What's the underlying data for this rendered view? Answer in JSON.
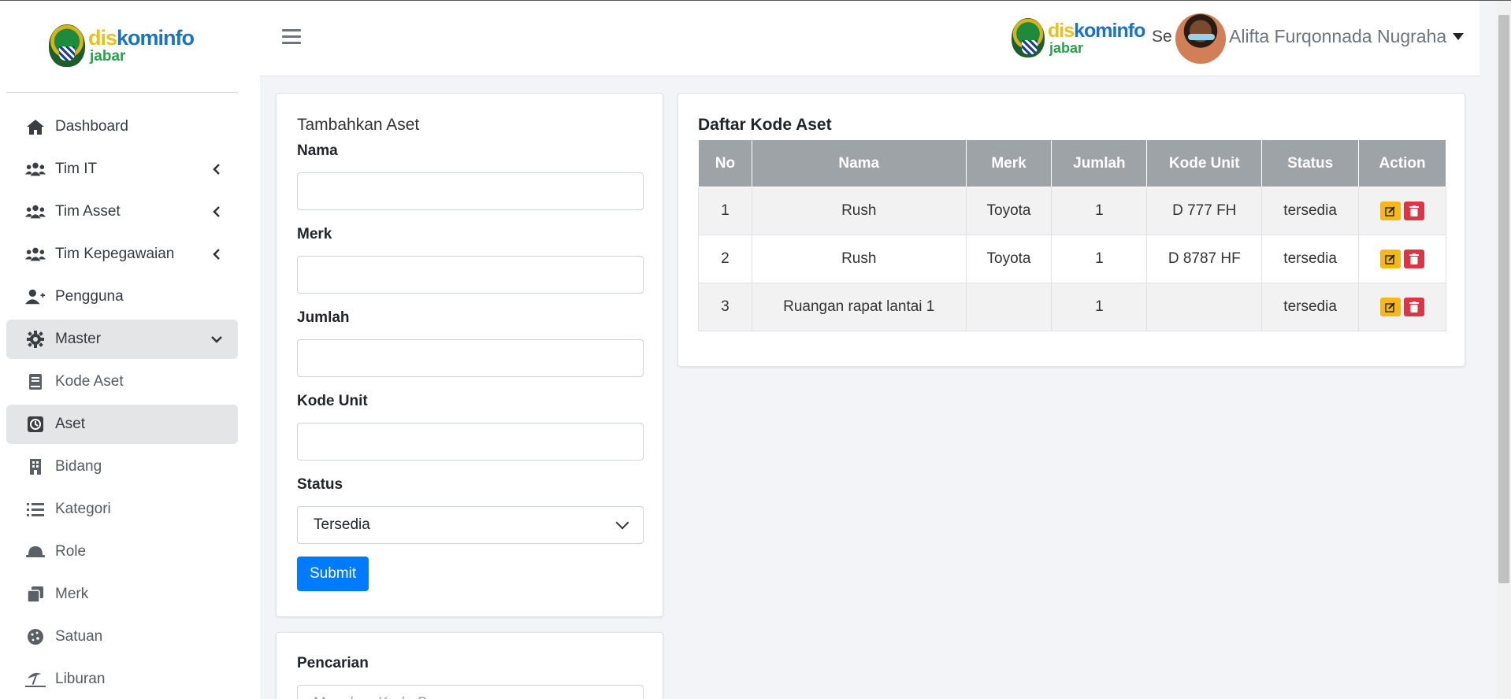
{
  "sidebar": {
    "brand": {
      "part1": "dis",
      "part2": "kominfo",
      "part3": "jabar"
    },
    "items": [
      {
        "label": "Dashboard",
        "icon": "home-icon"
      },
      {
        "label": "Tim IT",
        "icon": "users-icon",
        "has_chevron": true
      },
      {
        "label": "Tim Asset",
        "icon": "users-icon",
        "has_chevron": true
      },
      {
        "label": "Tim Kepegawaian",
        "icon": "users-icon",
        "has_chevron": true
      },
      {
        "label": "Pengguna",
        "icon": "user-plus-icon"
      },
      {
        "label": "Master",
        "icon": "gear-icon",
        "expanded": true
      },
      {
        "label": "Kode Aset",
        "icon": "book-icon"
      },
      {
        "label": "Aset",
        "icon": "clock-icon",
        "active": true
      },
      {
        "label": "Bidang",
        "icon": "building-icon"
      },
      {
        "label": "Kategori",
        "icon": "list-icon"
      },
      {
        "label": "Role",
        "icon": "helmet-icon"
      },
      {
        "label": "Merk",
        "icon": "copy-icon"
      },
      {
        "label": "Satuan",
        "icon": "cookie-icon"
      },
      {
        "label": "Liburan",
        "icon": "umbrella-beach-icon"
      }
    ]
  },
  "header": {
    "brand": {
      "part1": "dis",
      "part2": "kominfo",
      "part3": "jabar"
    },
    "truncated_text": "Se",
    "username": "Alifta Furqonnada Nugraha"
  },
  "form": {
    "title": "Tambahkan Aset",
    "labels": {
      "nama": "Nama",
      "merk": "Merk",
      "jumlah": "Jumlah",
      "kode_unit": "Kode Unit",
      "status": "Status"
    },
    "values": {
      "nama": "",
      "merk": "",
      "jumlah": "",
      "kode_unit": ""
    },
    "status_selected": "Tersedia",
    "submit_label": "Submit"
  },
  "search": {
    "label": "Pencarian",
    "placeholder": "Masukan Kode Barang"
  },
  "table": {
    "title": "Daftar Kode Aset",
    "headers": [
      "No",
      "Nama",
      "Merk",
      "Jumlah",
      "Kode Unit",
      "Status",
      "Action"
    ],
    "rows": [
      [
        "1",
        "Rush",
        "Toyota",
        "1",
        "D 777 FH",
        "tersedia"
      ],
      [
        "2",
        "Rush",
        "Toyota",
        "1",
        "D 8787 HF",
        "tersedia"
      ],
      [
        "3",
        "Ruangan rapat lantai 1",
        "",
        "1",
        "",
        "tersedia"
      ]
    ]
  },
  "colors": {
    "primary": "#007bff",
    "table_header": "#9ea3a8",
    "edit": "#f6b817",
    "delete": "#dc3545",
    "active_nav": "#e4e5e6"
  }
}
